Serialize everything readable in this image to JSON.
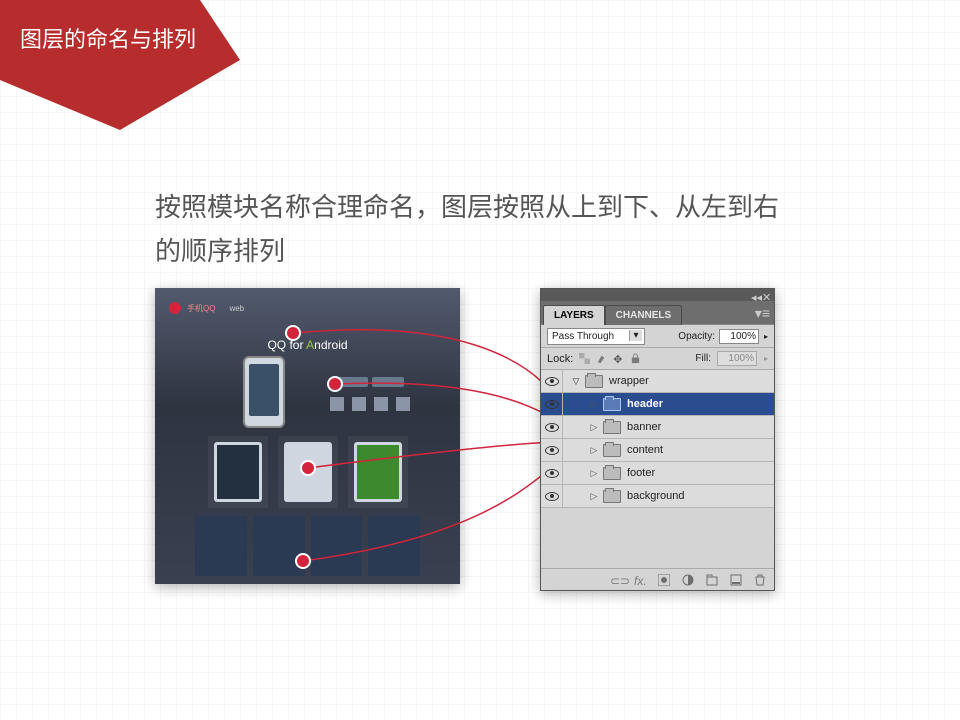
{
  "ribbon": {
    "title": "图层的命名与排列"
  },
  "body_text": "按照模块名称合理命名，图层按照从上到下、从左到右的顺序排列",
  "mockup": {
    "brand": "手机QQ",
    "nav_word": "web",
    "hero_title_pre": "QQ for ",
    "hero_title_em": "A",
    "hero_title_post": "ndroid"
  },
  "layers_panel": {
    "tabs": [
      "LAYERS",
      "CHANNELS"
    ],
    "blend_mode": "Pass Through",
    "opacity_label": "Opacity:",
    "opacity_value": "100%",
    "lock_label": "Lock:",
    "fill_label": "Fill:",
    "fill_value": "100%",
    "rows": [
      {
        "name": "wrapper",
        "indent": 0,
        "open": true,
        "selected": false
      },
      {
        "name": "header",
        "indent": 1,
        "open": false,
        "selected": true
      },
      {
        "name": "banner",
        "indent": 1,
        "open": false,
        "selected": false
      },
      {
        "name": "content",
        "indent": 1,
        "open": false,
        "selected": false
      },
      {
        "name": "footer",
        "indent": 1,
        "open": false,
        "selected": false
      },
      {
        "name": "background",
        "indent": 1,
        "open": false,
        "selected": false
      }
    ]
  }
}
